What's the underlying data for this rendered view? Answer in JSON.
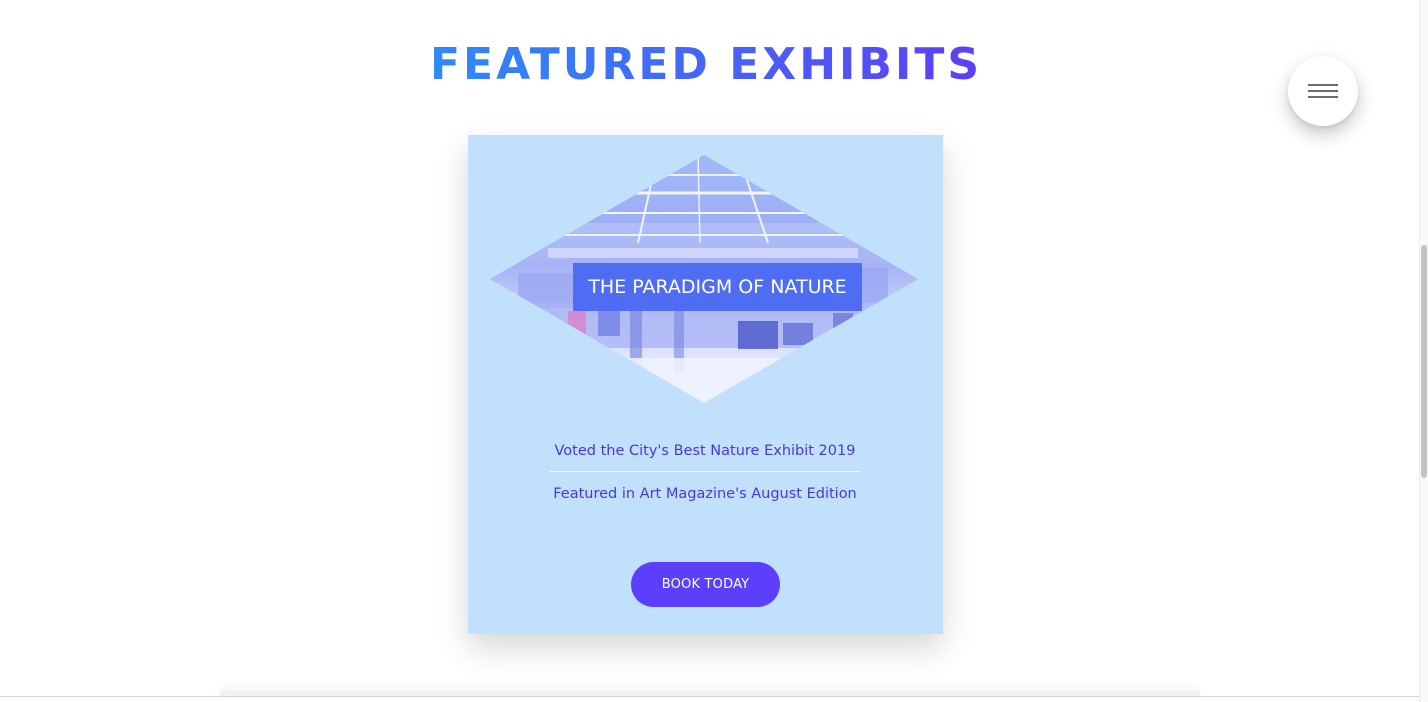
{
  "section": {
    "title": "FEATURED EXHIBITS"
  },
  "menu": {
    "icon": "hamburger-menu-icon"
  },
  "exhibit_card": {
    "title": "THE PARADIGM OF NATURE",
    "image": "gallery-interior-photo",
    "features": [
      "Voted the City's Best Nature Exhibit 2019",
      "Featured in Art Magazine's August Edition"
    ],
    "cta_label": "BOOK TODAY"
  },
  "colors": {
    "title_gradient_start": "#2e8bf7",
    "title_gradient_end": "#5d3ff5",
    "card_background": "#c0e0fc",
    "feature_text": "#4a36e6",
    "title_banner": "#4e6df3",
    "cta_background": "#5b3ffb"
  }
}
